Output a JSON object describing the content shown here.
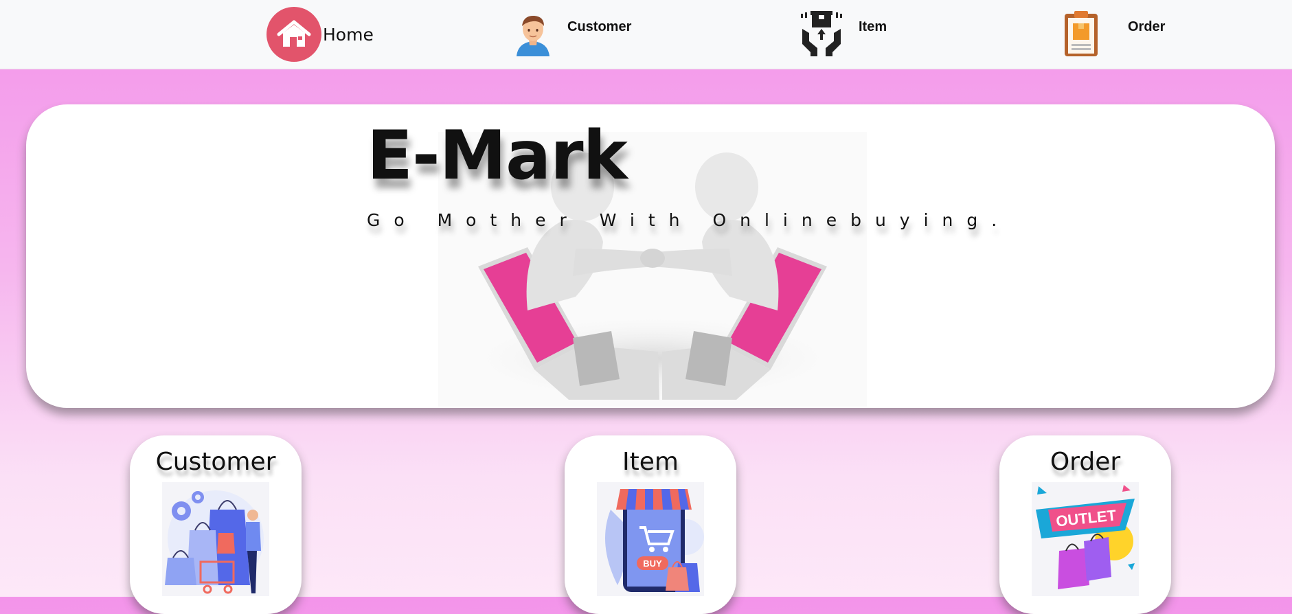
{
  "nav": {
    "home_label": "Home",
    "customer_label": "Customer",
    "item_label": "Item",
    "order_label": "Order"
  },
  "hero": {
    "title": "E-Mark",
    "tagline": "Go Mother With Onlinebuying."
  },
  "cards": {
    "customer_title": "Customer",
    "item_title": "Item",
    "item_buy_text": "BUY",
    "order_title": "Order",
    "order_outlet_text": "OUTLET"
  },
  "icons": {
    "home": "home-icon",
    "customer": "customer-avatar-icon",
    "item": "item-box-hands-icon",
    "order": "order-clipboard-icon"
  },
  "colors": {
    "home_accent": "#e2546b",
    "laptop_pink": "#e8449c",
    "background_top": "#f394ea",
    "background_bottom": "#fde8f8"
  }
}
